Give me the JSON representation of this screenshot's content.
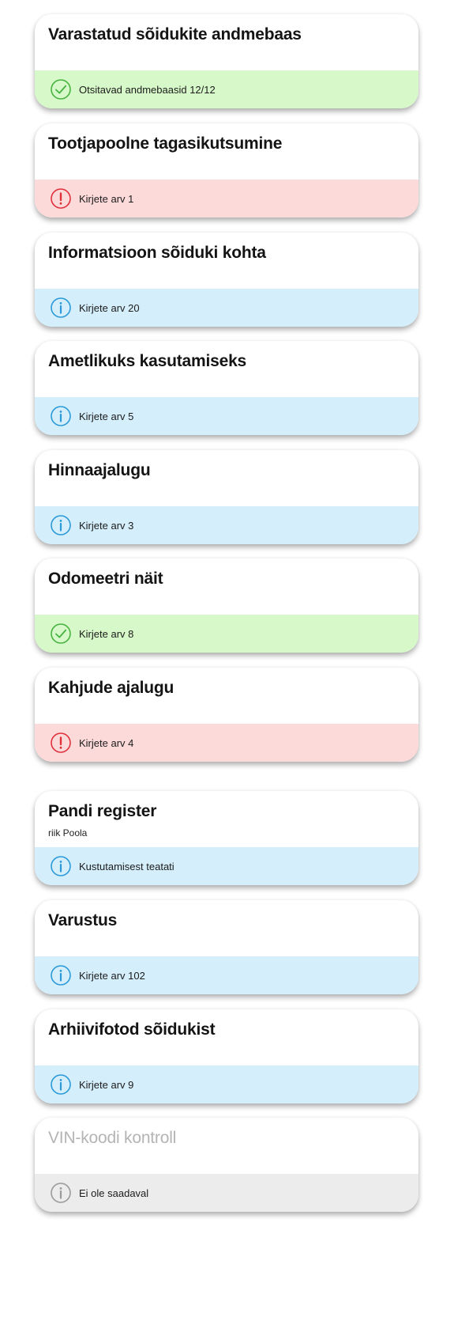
{
  "cards": [
    {
      "title": "Varastatud sõidukite andmebaas",
      "subtitle": "",
      "status": "success",
      "status_text": "Otsitavad andmebaasid 12/12",
      "icon": "check-icon"
    },
    {
      "title": "Tootjapoolne tagasikutsumine",
      "subtitle": "",
      "status": "error",
      "status_text": "Kirjete arv 1",
      "icon": "exclamation-icon"
    },
    {
      "title": "Informatsioon sõiduki kohta",
      "subtitle": "",
      "status": "info",
      "status_text": "Kirjete arv 20",
      "icon": "info-icon"
    },
    {
      "title": "Ametlikuks kasutamiseks",
      "subtitle": "",
      "status": "info",
      "status_text": "Kirjete arv 5",
      "icon": "info-icon"
    },
    {
      "title": "Hinnaajalugu",
      "subtitle": "",
      "status": "info",
      "status_text": "Kirjete arv 3",
      "icon": "info-icon"
    },
    {
      "title": "Odomeetri näit",
      "subtitle": "",
      "status": "success",
      "status_text": "Kirjete arv 8",
      "icon": "check-icon"
    },
    {
      "title": "Kahjude ajalugu",
      "subtitle": "",
      "status": "error",
      "status_text": "Kirjete arv 4",
      "icon": "exclamation-icon"
    },
    {
      "title": "Pandi register",
      "subtitle": "riik Poola",
      "status": "info",
      "status_text": "Kustutamisest teatati",
      "icon": "info-icon"
    },
    {
      "title": "Varustus",
      "subtitle": "",
      "status": "info",
      "status_text": "Kirjete arv 102",
      "icon": "info-icon"
    },
    {
      "title": "Arhiivifotod sõidukist",
      "subtitle": "",
      "status": "info",
      "status_text": "Kirjete arv 9",
      "icon": "info-icon"
    },
    {
      "title": "VIN-koodi kontroll",
      "subtitle": "",
      "status": "neutral",
      "status_text": "Ei ole saadaval",
      "icon": "info-icon"
    }
  ],
  "colors": {
    "success_bg": "#d7f8c8",
    "success_icon": "#46b341",
    "error_bg": "#fddada",
    "error_icon": "#e0303a",
    "info_bg": "#d5eefb",
    "info_icon": "#2a9ad8",
    "neutral_bg": "#ececec",
    "neutral_icon": "#9a9a9a"
  }
}
